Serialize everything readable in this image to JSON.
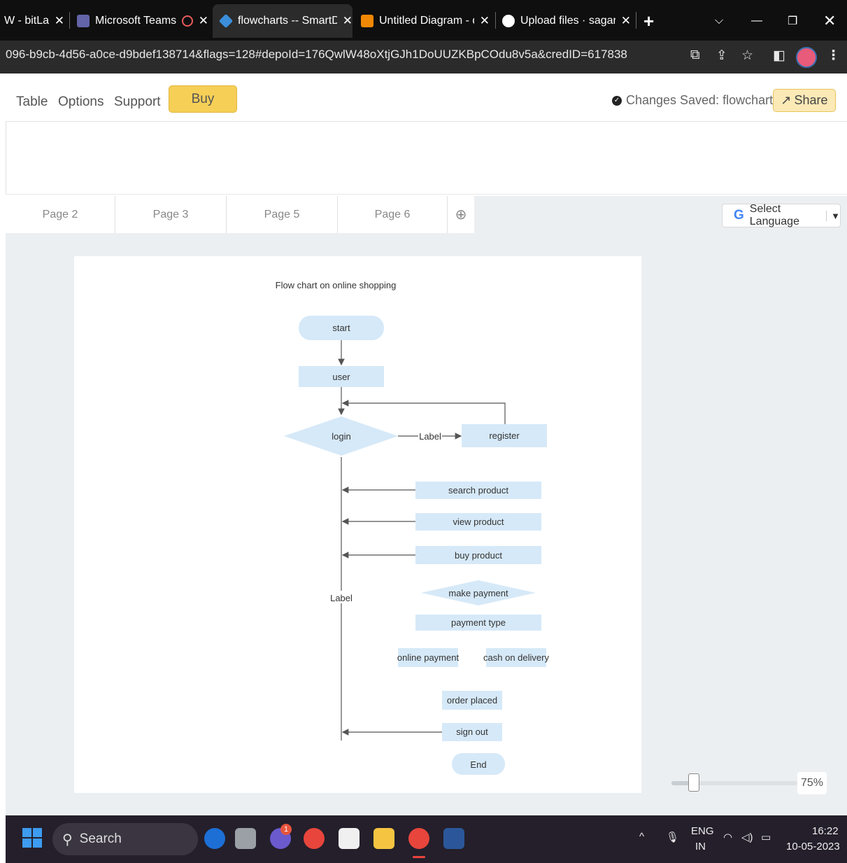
{
  "browser": {
    "tabs": [
      {
        "title": "W - bitLat",
        "icon": "bitlab-icon",
        "color": "#444444"
      },
      {
        "title": "Microsoft Teams",
        "icon": "teams-icon",
        "color": "#6264a7"
      },
      {
        "title": "flowcharts -- SmartDr",
        "icon": "smartdraw-icon",
        "color": "#3b8ed9"
      },
      {
        "title": "Untitled Diagram - dia",
        "icon": "drawio-icon",
        "color": "#f08705"
      },
      {
        "title": "Upload files · sagarba",
        "icon": "github-icon",
        "color": "#ffffff"
      }
    ],
    "new_tab": "+",
    "url": "096-b9cb-4d56-a0ce-d9bdef138714&flags=128#depoId=176QwlW48oXtjGJh1DoUUZKBpCOdu8v5a&credID=617838"
  },
  "app": {
    "menu": [
      "Table",
      "Options",
      "Support"
    ],
    "buy_label": "Buy",
    "saved_text": "Changes Saved: flowcharts",
    "share_label": "Share",
    "pages": [
      "Page 2",
      "Page 3",
      "Page 5",
      "Page 6"
    ],
    "add_page": "⊕",
    "language_label": "Select Language",
    "zoom": {
      "value": "75%",
      "fraction": 0.17
    }
  },
  "diagram": {
    "title": "Flow chart on online shopping",
    "nodes": {
      "start": "start",
      "user": "user",
      "login": "login",
      "register": "register",
      "search": "search product",
      "view": "view product",
      "buy": "buy product",
      "payment": "make payment",
      "type": "payment type",
      "online": "online payment",
      "cod": "cash on delivery",
      "order": "order placed",
      "signout": "sign out",
      "end": "End"
    },
    "edge_label_register": "Label",
    "edge_label_main": "Label",
    "fill": "#d6e9f8",
    "stroke": "#555555"
  },
  "taskbar": {
    "search_label": "Search",
    "badge": "1",
    "lang_top": "ENG",
    "lang_bottom": "IN",
    "time": "16:22",
    "date": "10-05-2023"
  }
}
